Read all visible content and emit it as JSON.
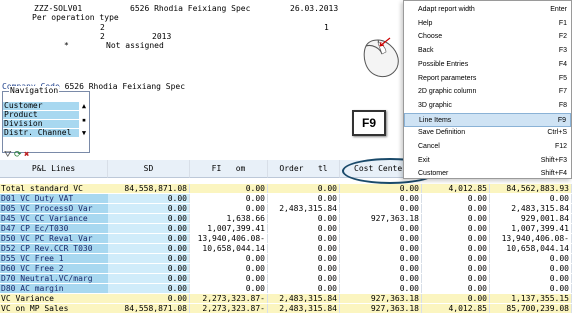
{
  "header": {
    "line1_left": "ZZZ-SOLV01",
    "line1_mid": "6526 Rhodia Feixiang Spec",
    "line1_date": "26.03.2013",
    "line2": "Per operation type",
    "line3_a": "2",
    "line3_b": "1",
    "line4_a": "2",
    "line4_b": "2013",
    "line5_star": "*",
    "line5_b": "Not assigned"
  },
  "company": {
    "label": "Company Code",
    "value": "6526 Rhodia Feixiang Spec"
  },
  "navigation": {
    "title": "Navigation",
    "items": [
      "Customer",
      "Product",
      "Division",
      "Distr. Channel"
    ]
  },
  "key_callout": "F9",
  "grid": {
    "headers": [
      "P&L Lines",
      "SD",
      "FI   om",
      "Order   tl",
      "Cost Center",
      "",
      ""
    ],
    "rows": [
      {
        "label": "Total standard VC",
        "v": [
          "84,558,871.08",
          "0.00",
          "0.00",
          "0.00",
          "4,012.85",
          "84,562,883.93"
        ],
        "yel": true
      },
      {
        "label": "D01 VC Duty VAT",
        "v": [
          "0.00",
          "0.00",
          "0.00",
          "0.00",
          "0.00",
          "0.00"
        ]
      },
      {
        "label": "D05 VC ProcessO Var",
        "v": [
          "0.00",
          "0.00",
          "2,483,315.84",
          "0.00",
          "0.00",
          "2,483,315.84"
        ]
      },
      {
        "label": "D45 VC CC Variance",
        "v": [
          "0.00",
          "1,638.66",
          "0.00",
          "927,363.18",
          "0.00",
          "929,001.84"
        ]
      },
      {
        "label": "D47 CP Ec/T030",
        "v": [
          "0.00",
          "1,007,399.41",
          "0.00",
          "0.00",
          "0.00",
          "1,007,399.41"
        ]
      },
      {
        "label": "D50 VC PC Reval Var",
        "v": [
          "0.00",
          "13,940,406.08-",
          "0.00",
          "0.00",
          "0.00",
          "13,940,406.08-"
        ]
      },
      {
        "label": "D52 CP Rev.CCR T030",
        "v": [
          "0.00",
          "10,658,044.14",
          "0.00",
          "0.00",
          "0.00",
          "10,658,044.14"
        ]
      },
      {
        "label": "D55 VC Free 1",
        "v": [
          "0.00",
          "0.00",
          "0.00",
          "0.00",
          "0.00",
          "0.00"
        ]
      },
      {
        "label": "D60 VC Free 2",
        "v": [
          "0.00",
          "0.00",
          "0.00",
          "0.00",
          "0.00",
          "0.00"
        ]
      },
      {
        "label": "D70 Neutral.VC/marg",
        "v": [
          "0.00",
          "0.00",
          "0.00",
          "0.00",
          "0.00",
          "0.00"
        ]
      },
      {
        "label": "D80 AC margin",
        "v": [
          "0.00",
          "0.00",
          "0.00",
          "0.00",
          "0.00",
          "0.00"
        ]
      },
      {
        "label": "VC Variance",
        "v": [
          "0.00",
          "2,273,323.87-",
          "2,483,315.84",
          "927,363.18",
          "0.00",
          "1,137,355.15"
        ],
        "yel": true
      },
      {
        "label": "VC on MP Sales",
        "v": [
          "84,558,871.08",
          "2,273,323.87-",
          "2,483,315.84",
          "927,363.18",
          "4,012.85",
          "85,700,239.08"
        ],
        "yel": true
      }
    ]
  },
  "context_menu": {
    "items": [
      {
        "label": "Adapt report width",
        "key": "Enter"
      },
      {
        "label": "Help",
        "key": "F1"
      },
      {
        "label": "Choose",
        "key": "F2"
      },
      {
        "label": "Back",
        "key": "F3"
      },
      {
        "label": "Possible Entries",
        "key": "F4"
      },
      {
        "label": "Report parameters",
        "key": "F5"
      },
      {
        "label": "2D graphic column",
        "key": "F7"
      },
      {
        "label": "3D graphic",
        "key": "F8"
      },
      {
        "label": "Line Items",
        "key": "F9",
        "highlight": true
      },
      {
        "label": "Save Definition",
        "key": "Ctrl+S"
      },
      {
        "label": "Cancel",
        "key": "F12"
      },
      {
        "label": "Exit",
        "key": "Shift+F3"
      },
      {
        "label": "Customer",
        "key": "Shift+F4"
      }
    ]
  }
}
